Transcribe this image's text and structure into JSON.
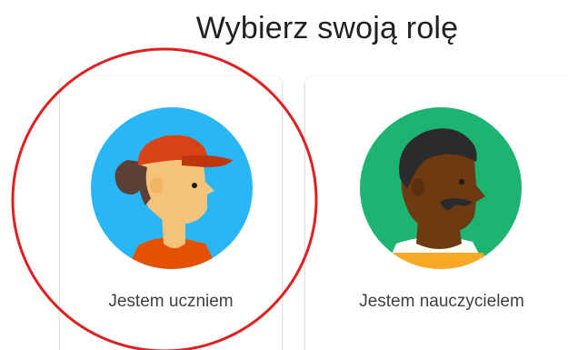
{
  "header": {
    "title": "Wybierz swoją rolę"
  },
  "roles": [
    {
      "label": "Jestem uczniem",
      "icon": "student-avatar-icon",
      "background_color": "#29b6f6"
    },
    {
      "label": "Jestem nauczycielem",
      "icon": "teacher-avatar-icon",
      "background_color": "#1db371"
    }
  ],
  "annotation": {
    "type": "red-circle-highlight",
    "target": "Jestem uczniem",
    "color": "#e02020"
  }
}
